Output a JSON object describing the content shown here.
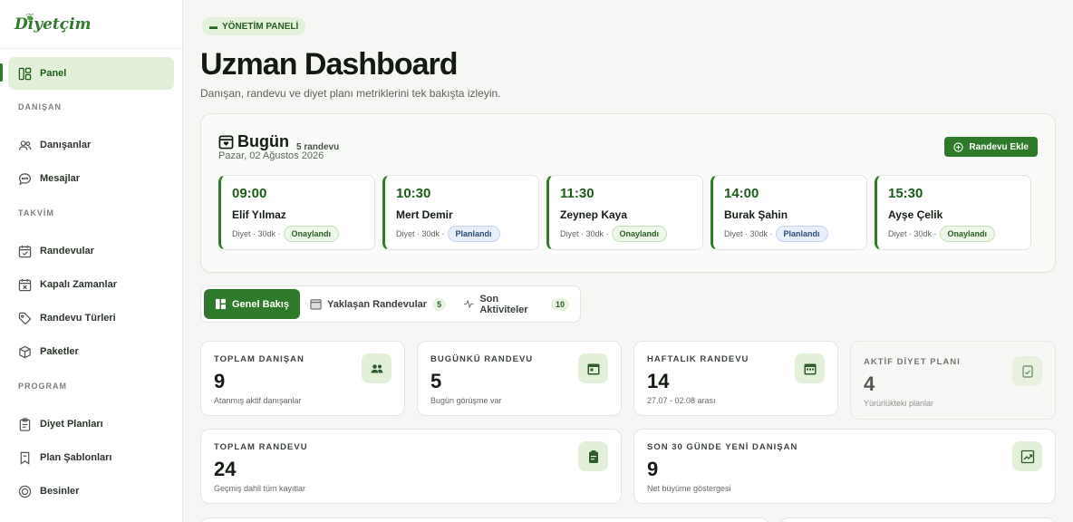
{
  "brand": {
    "logo_text": "Diyetçim"
  },
  "sidebar": {
    "active": {
      "label": "Panel",
      "icon": "layout-icon"
    },
    "sections": {
      "danisan": "DANIŞAN",
      "takvim": "TAKVİM",
      "program": "PROGRAM"
    },
    "items": {
      "danisanlar": "Danışanlar",
      "mesajlar": "Mesajlar",
      "randevular": "Randevular",
      "kapali": "Kapalı Zamanlar",
      "turler": "Randevu Türleri",
      "paketler": "Paketler",
      "diyet_planlari": "Diyet Planları",
      "sablonlar": "Plan Şablonları",
      "besinler": "Besinler"
    }
  },
  "header": {
    "chip": "YÖNETİM PANELİ",
    "title": "Uzman Dashboard",
    "subtitle": "Danışan, randevu ve diyet planı metriklerini tek bakışta izleyin."
  },
  "today": {
    "title": "Bugün",
    "count": "5 randevu",
    "date": "Pazar, 02 Ağustos 2026",
    "add_button": "Randevu Ekle",
    "appointments": [
      {
        "time": "09:00",
        "name": "Elif Yılmaz",
        "meta": "Diyet · 30dk ·",
        "status": "Onaylandı",
        "status_type": "ok"
      },
      {
        "time": "10:30",
        "name": "Mert Demir",
        "meta": "Diyet · 30dk ·",
        "status": "Planlandı",
        "status_type": "plan"
      },
      {
        "time": "11:30",
        "name": "Zeynep Kaya",
        "meta": "Diyet · 30dk ·",
        "status": "Onaylandı",
        "status_type": "ok"
      },
      {
        "time": "14:00",
        "name": "Burak Şahin",
        "meta": "Diyet · 30dk ·",
        "status": "Planlandı",
        "status_type": "plan"
      },
      {
        "time": "15:30",
        "name": "Ayşe Çelik",
        "meta": "Diyet · 30dk ·",
        "status": "Onaylandı",
        "status_type": "ok"
      }
    ]
  },
  "tabs": {
    "overview": "Genel Bakış",
    "upcoming": "Yaklaşan Randevular",
    "upcoming_count": "5",
    "activity": "Son Aktiviteler",
    "activity_count": "10"
  },
  "stats": {
    "total_clients": {
      "label": "TOPLAM DANIŞAN",
      "value": "9",
      "note": "Atanmış aktif danışanlar"
    },
    "today_appts": {
      "label": "BUGÜNKÜ RANDEVU",
      "value": "5",
      "note": "Bugün görüşme var"
    },
    "weekly_appts": {
      "label": "HAFTALIK RANDEVU",
      "value": "14",
      "note": "27.07 - 02.08 arası"
    },
    "active_plans": {
      "label": "AKTİF DİYET PLANI",
      "value": "4",
      "note": "Yürürlükteki planlar"
    },
    "total_appts": {
      "label": "TOPLAM RANDEVU",
      "value": "24",
      "note": "Geçmiş dahil tüm kayıtlar"
    },
    "new_clients": {
      "label": "SON 30 GÜNDE YENİ DANIŞAN",
      "value": "9",
      "note": "Net büyüme göstergesi"
    }
  },
  "colors": {
    "accent": "#2f7a2a",
    "accent_light": "#e3f0d9"
  }
}
